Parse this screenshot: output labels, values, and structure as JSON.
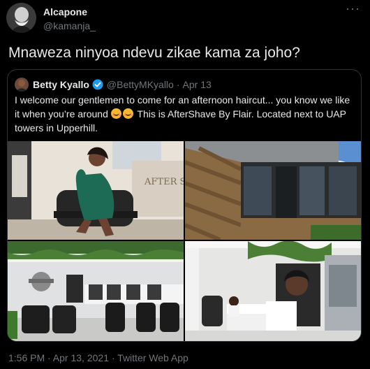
{
  "tweet": {
    "display_name": "Alcapone",
    "handle": "@kamanja_",
    "more_label": "···",
    "text": "Mnaweza ninyoa ndevu zikae kama za joho?",
    "timestamp": "1:56 PM · Apr 13, 2021 · Twitter Web App"
  },
  "quoted": {
    "display_name": "Betty Kyallo",
    "handle": "@BettyMKyallo",
    "separator": "·",
    "date": "Apr 13",
    "text_part1": "I welcome our gentlemen to come for an afternoon haircut... you know we like it when you’re around ",
    "text_part2": " This is AfterShave By Flair. Located next to UAP towers in Upperhill.",
    "emojis": [
      "smiling-face-with-smiling-eyes",
      "smiling-face-with-smiling-eyes"
    ],
    "photos": [
      {
        "name": "woman-in-green-dress-seated-in-barber-chair"
      },
      {
        "name": "wooden-shop-front-exterior"
      },
      {
        "name": "barbershop-interior-with-chairs-and-leaf-ceiling"
      },
      {
        "name": "barbershop-interior-with-portrait-wall"
      }
    ],
    "photo_sign_text": "AFTER SHAVE"
  },
  "colors": {
    "background": "#000000",
    "primary_text": "#e7e9ea",
    "secondary_text": "#71767b",
    "border": "#2f3336",
    "verified": "#1d9bf0"
  }
}
